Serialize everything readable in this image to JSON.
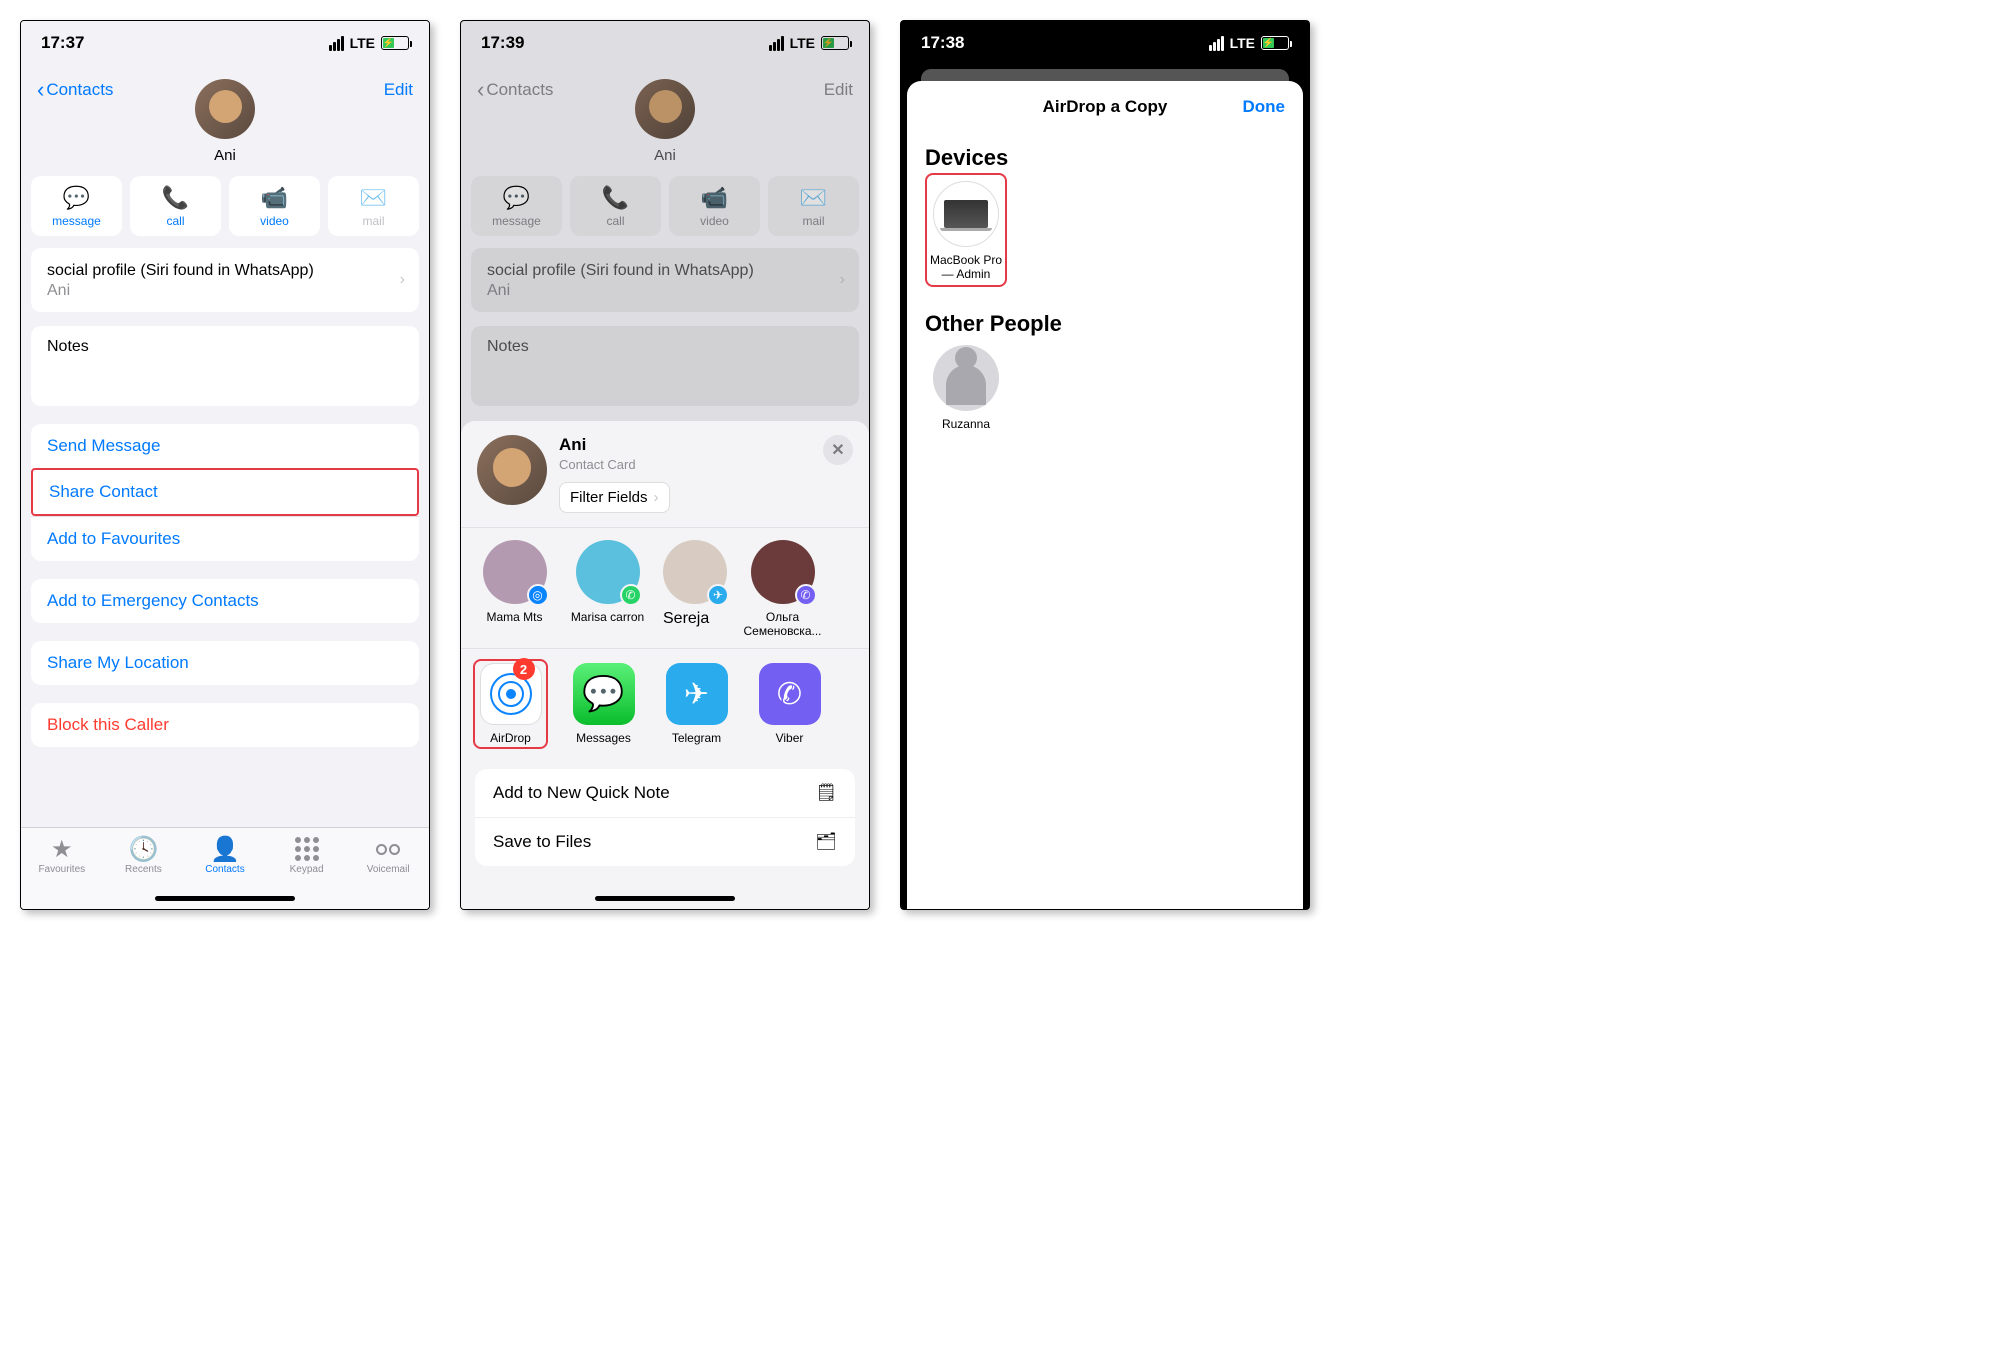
{
  "screen1": {
    "time": "17:37",
    "network": "LTE",
    "back_label": "Contacts",
    "edit_label": "Edit",
    "contact_name": "Ani",
    "actions": {
      "message": "message",
      "call": "call",
      "video": "video",
      "mail": "mail"
    },
    "social_profile_label": "social profile (Siri found in WhatsApp)",
    "social_profile_value": "Ani",
    "notes_label": "Notes",
    "rows": {
      "send_message": "Send Message",
      "share_contact": "Share Contact",
      "add_favourites": "Add to Favourites",
      "add_emergency": "Add to Emergency Contacts",
      "share_location": "Share My Location",
      "block": "Block this Caller"
    },
    "tabs": {
      "favourites": "Favourites",
      "recents": "Recents",
      "contacts": "Contacts",
      "keypad": "Keypad",
      "voicemail": "Voicemail"
    }
  },
  "screen2": {
    "time": "17:39",
    "network": "LTE",
    "back_label": "Contacts",
    "edit_label": "Edit",
    "contact_name": "Ani",
    "actions": {
      "message": "message",
      "call": "call",
      "video": "video",
      "mail": "mail"
    },
    "social_profile_label": "social profile (Siri found in WhatsApp)",
    "social_profile_value": "Ani",
    "notes_label": "Notes",
    "share": {
      "name": "Ani",
      "subtitle": "Contact Card",
      "filter_label": "Filter Fields",
      "people": [
        {
          "name": "Mama Mts",
          "badge_color": "#0a84ff",
          "avatar_color": "#b49ab0"
        },
        {
          "name": "Marisa carron",
          "badge_color": "#25d366",
          "avatar_color": "#5bc0de"
        },
        {
          "name": "Sereja",
          "badge_color": "#2aabee",
          "avatar_color": "#d8ccc2"
        },
        {
          "name": "Ольга Семеновска...",
          "badge_color": "#7360f2",
          "avatar_color": "#6b3a3a"
        }
      ],
      "apps": [
        {
          "name": "AirDrop",
          "bg": "#ffffff",
          "badge": "2",
          "highlighted": true
        },
        {
          "name": "Messages",
          "bg": "#34c759"
        },
        {
          "name": "Telegram",
          "bg": "#2aabee"
        },
        {
          "name": "Viber",
          "bg": "#7360f2"
        }
      ],
      "more": {
        "quick_note": "Add to New Quick Note",
        "save_files": "Save to Files"
      }
    }
  },
  "screen3": {
    "time": "17:38",
    "network": "LTE",
    "title": "AirDrop a Copy",
    "done": "Done",
    "devices_label": "Devices",
    "devices": [
      {
        "name": "MacBook Pro — Admin",
        "highlighted": true
      }
    ],
    "other_people_label": "Other People",
    "people": [
      {
        "name": "Ruzanna"
      }
    ]
  }
}
